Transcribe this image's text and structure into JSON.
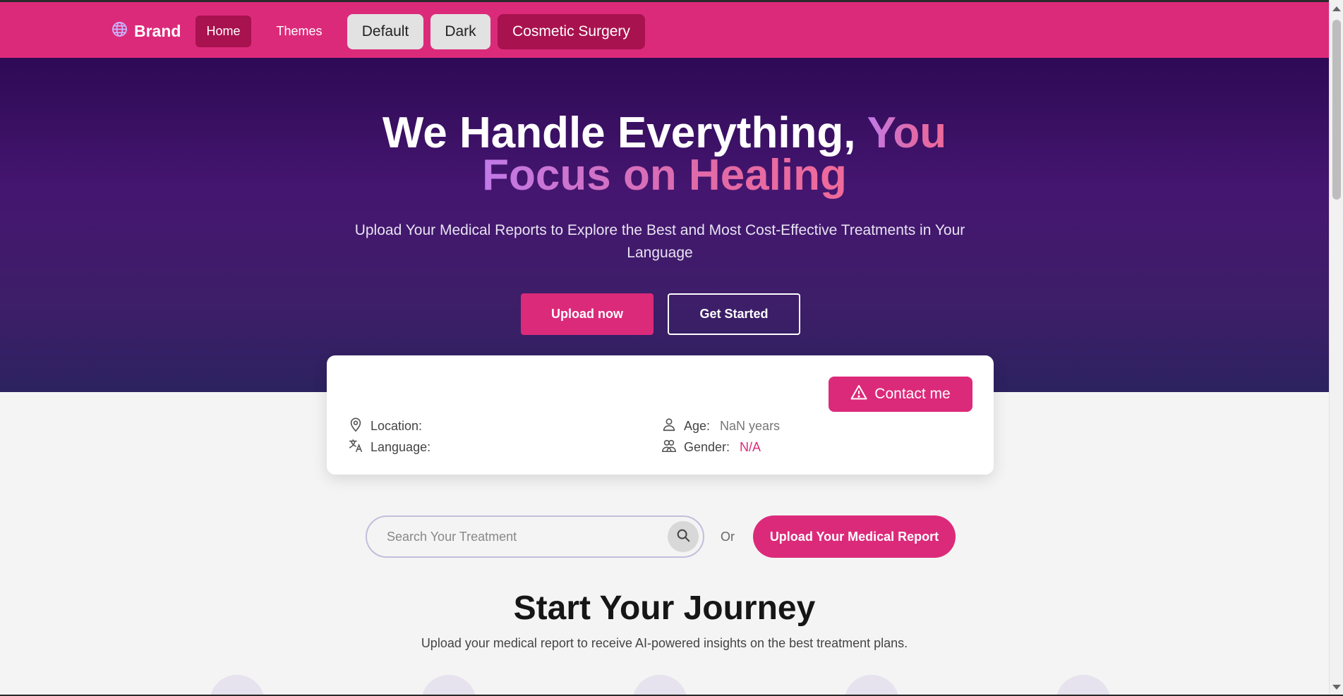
{
  "navbar": {
    "brand": "Brand",
    "home_label": "Home",
    "themes_label": "Themes",
    "theme_buttons": [
      "Default",
      "Dark",
      "Cosmetic Surgery"
    ]
  },
  "hero": {
    "title_plain": "We Handle Everything, ",
    "title_highlight_1": "You",
    "title_highlight_2": "Focus on Healing",
    "subtitle": "Upload Your Medical Reports to Explore the Best and Most Cost-Effective Treatments in Your Language",
    "upload_now": "Upload now",
    "get_started": "Get Started"
  },
  "profile": {
    "contact_label": "Contact me",
    "location_label": "Location:",
    "location_value": "",
    "language_label": "Language:",
    "language_value": "",
    "age_label": "Age:",
    "age_value": "NaN years",
    "gender_label": "Gender:",
    "gender_value": "N/A"
  },
  "search": {
    "placeholder": "Search Your Treatment",
    "or_text": "Or",
    "upload_report": "Upload Your Medical Report"
  },
  "journey": {
    "title": "Start Your Journey",
    "subtitle": "Upload your medical report to receive AI-powered insights on the best treatment plans."
  },
  "colors": {
    "accent": "#dc2a7a",
    "accent_dark": "#a8124f",
    "hero_top": "#2e0a55",
    "hero_bottom": "#2c2260"
  }
}
